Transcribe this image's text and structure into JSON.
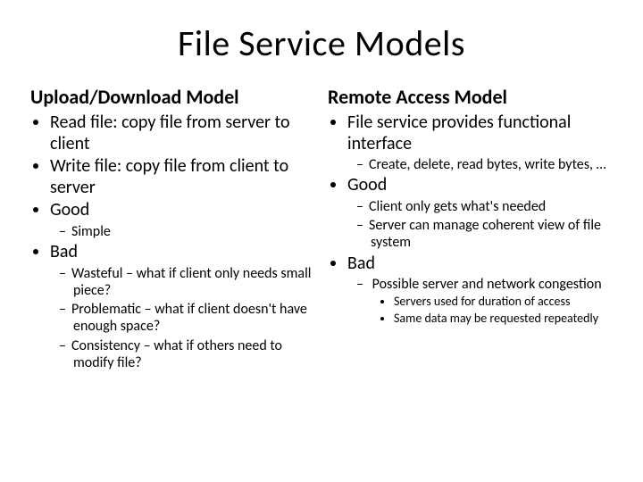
{
  "title": "File Service Models",
  "left": {
    "heading": "Upload/Download Model",
    "b1": "Read file: copy file from server to client",
    "b2": "Write file: copy file from client to server",
    "b3": "Good",
    "b3_sub1": "Simple",
    "b4": "Bad",
    "b4_sub1": "Wasteful – what if client only needs small piece?",
    "b4_sub2": "Problematic – what if client doesn't have enough space?",
    "b4_sub3": "Consistency – what if others need to modify file?"
  },
  "right": {
    "heading": "Remote Access Model",
    "b1": "File service provides functional interface",
    "b1_sub1": "Create, delete, read bytes, write bytes, …",
    "b2": "Good",
    "b2_sub1": "Client only gets what's needed",
    "b2_sub2": "Server can manage coherent view of file system",
    "b3": "Bad",
    "b3_sub1": "Possible server and network congestion",
    "b3_sub1_a": "Servers used for duration of access",
    "b3_sub1_b": "Same data may be requested repeatedly"
  }
}
